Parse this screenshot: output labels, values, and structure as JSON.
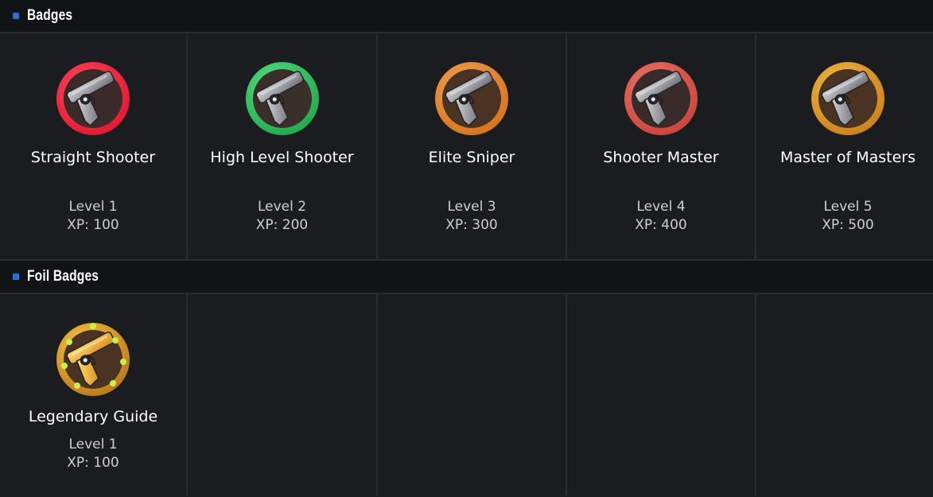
{
  "sections": {
    "badges": {
      "title": "Badges",
      "items": [
        {
          "name": "Straight Shooter",
          "level": "Level 1",
          "xp": "XP: 100",
          "ring_color": "#e0182f",
          "ring_light": "#ff4a5e",
          "center_color": "#3a2a2a"
        },
        {
          "name": "High Level Shooter",
          "level": "Level 2",
          "xp": "XP: 200",
          "ring_color": "#1fa84a",
          "ring_light": "#5fe38a",
          "center_color": "#3a2f2a"
        },
        {
          "name": "Elite Sniper",
          "level": "Level 3",
          "xp": "XP: 300",
          "ring_color": "#d4731c",
          "ring_light": "#f5a55a",
          "center_color": "#4a3322"
        },
        {
          "name": "Shooter Master",
          "level": "Level 4",
          "xp": "XP: 400",
          "ring_color": "#c9433a",
          "ring_light": "#f07a6d",
          "center_color": "#3a2b2b"
        },
        {
          "name": "Master of Masters",
          "level": "Level 5",
          "xp": "XP: 500",
          "ring_color": "#c97f1c",
          "ring_light": "#f3c14a",
          "center_color": "#4a3322"
        }
      ]
    },
    "foil": {
      "title": "Foil Badges",
      "items": [
        {
          "name": "Legendary Guide",
          "level": "Level 1",
          "xp": "XP: 100",
          "ring_color": "#b8761b",
          "ring_light": "#ffd24a",
          "center_color": "#4a3322"
        }
      ]
    }
  },
  "icons": {
    "badge": "pistol-badge-icon",
    "section_marker": "square-marker"
  },
  "colors": {
    "accent": "#2a6fd6",
    "background": "#1b1c20",
    "header_bg": "#121316"
  }
}
